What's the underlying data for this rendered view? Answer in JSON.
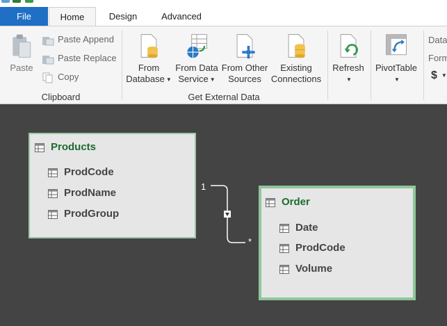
{
  "tabs": {
    "file": "File",
    "home": "Home",
    "design": "Design",
    "advanced": "Advanced"
  },
  "clipboard": {
    "paste": "Paste",
    "paste_append": "Paste Append",
    "paste_replace": "Paste Replace",
    "copy": "Copy",
    "group_label": "Clipboard"
  },
  "external_data": {
    "from_database_1": "From",
    "from_database_2": "Database",
    "from_data_service_1": "From Data",
    "from_data_service_2": "Service",
    "from_other_sources_1": "From Other",
    "from_other_sources_2": "Sources",
    "existing_connections_1": "Existing",
    "existing_connections_2": "Connections",
    "group_label": "Get External Data"
  },
  "refresh": {
    "label": "Refresh"
  },
  "pivot": {
    "label": "PivotTable"
  },
  "formatting": {
    "line1": "Data",
    "line2": "Form",
    "currency": "$"
  },
  "diagram": {
    "products": {
      "title": "Products",
      "columns": [
        "ProdCode",
        "ProdName",
        "ProdGroup"
      ]
    },
    "order": {
      "title": "Order",
      "columns": [
        "Date",
        "ProdCode",
        "Volume"
      ]
    },
    "relationship": {
      "one_label": "1",
      "many_label": "*"
    }
  },
  "colors": {
    "file_tab": "#1f6fc5",
    "table_title": "#1d6b2e",
    "table_border": "#8fc69a",
    "canvas": "#444444"
  }
}
